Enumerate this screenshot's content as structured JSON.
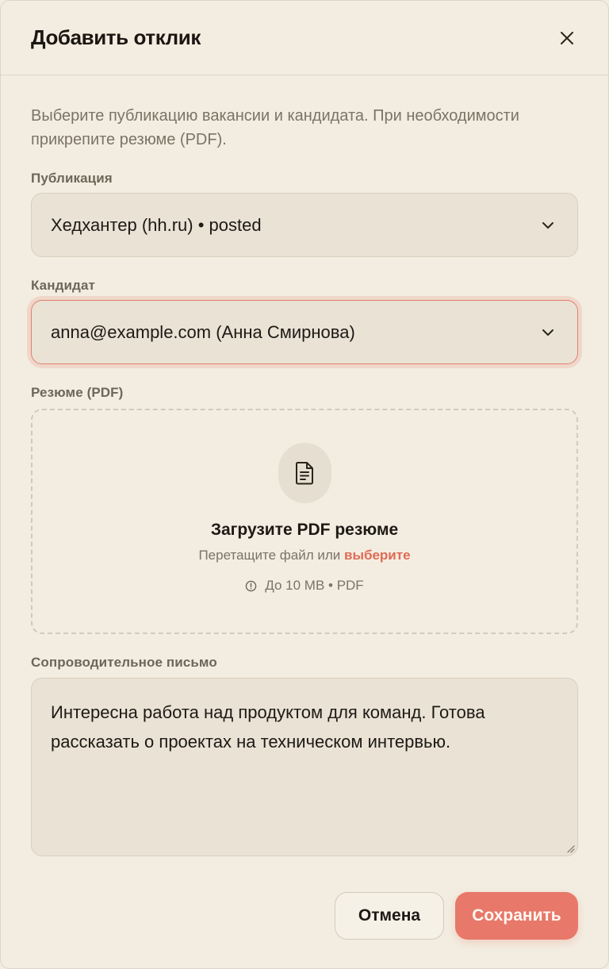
{
  "modal": {
    "title": "Добавить отклик",
    "description": "Выберите публикацию вакансии и кандидата. При необходимости прикрепите резюме (PDF)."
  },
  "fields": {
    "publication": {
      "label": "Публикация",
      "value": "Хедхантер (hh.ru) • posted"
    },
    "candidate": {
      "label": "Кандидат",
      "value": "anna@example.com (Анна Смирнова)"
    },
    "resume": {
      "label": "Резюме (PDF)",
      "title": "Загрузите PDF резюме",
      "hint_prefix": "Перетащите файл или",
      "hint_link": "выберите",
      "limits": "До 10 MB • PDF"
    },
    "cover_letter": {
      "label": "Сопроводительное письмо",
      "value": "Интересна работа над продуктом для команд. Готова рассказать о проектах на техническом интервью."
    }
  },
  "footer": {
    "cancel_label": "Отмена",
    "save_label": "Сохранить"
  },
  "icons": {
    "close": "close-icon",
    "chevron": "chevron-down-icon",
    "file": "file-text-icon",
    "info": "info-circle-icon"
  },
  "colors": {
    "accent": "#e8786a",
    "link": "#e06a55",
    "background": "#f3ede1"
  }
}
